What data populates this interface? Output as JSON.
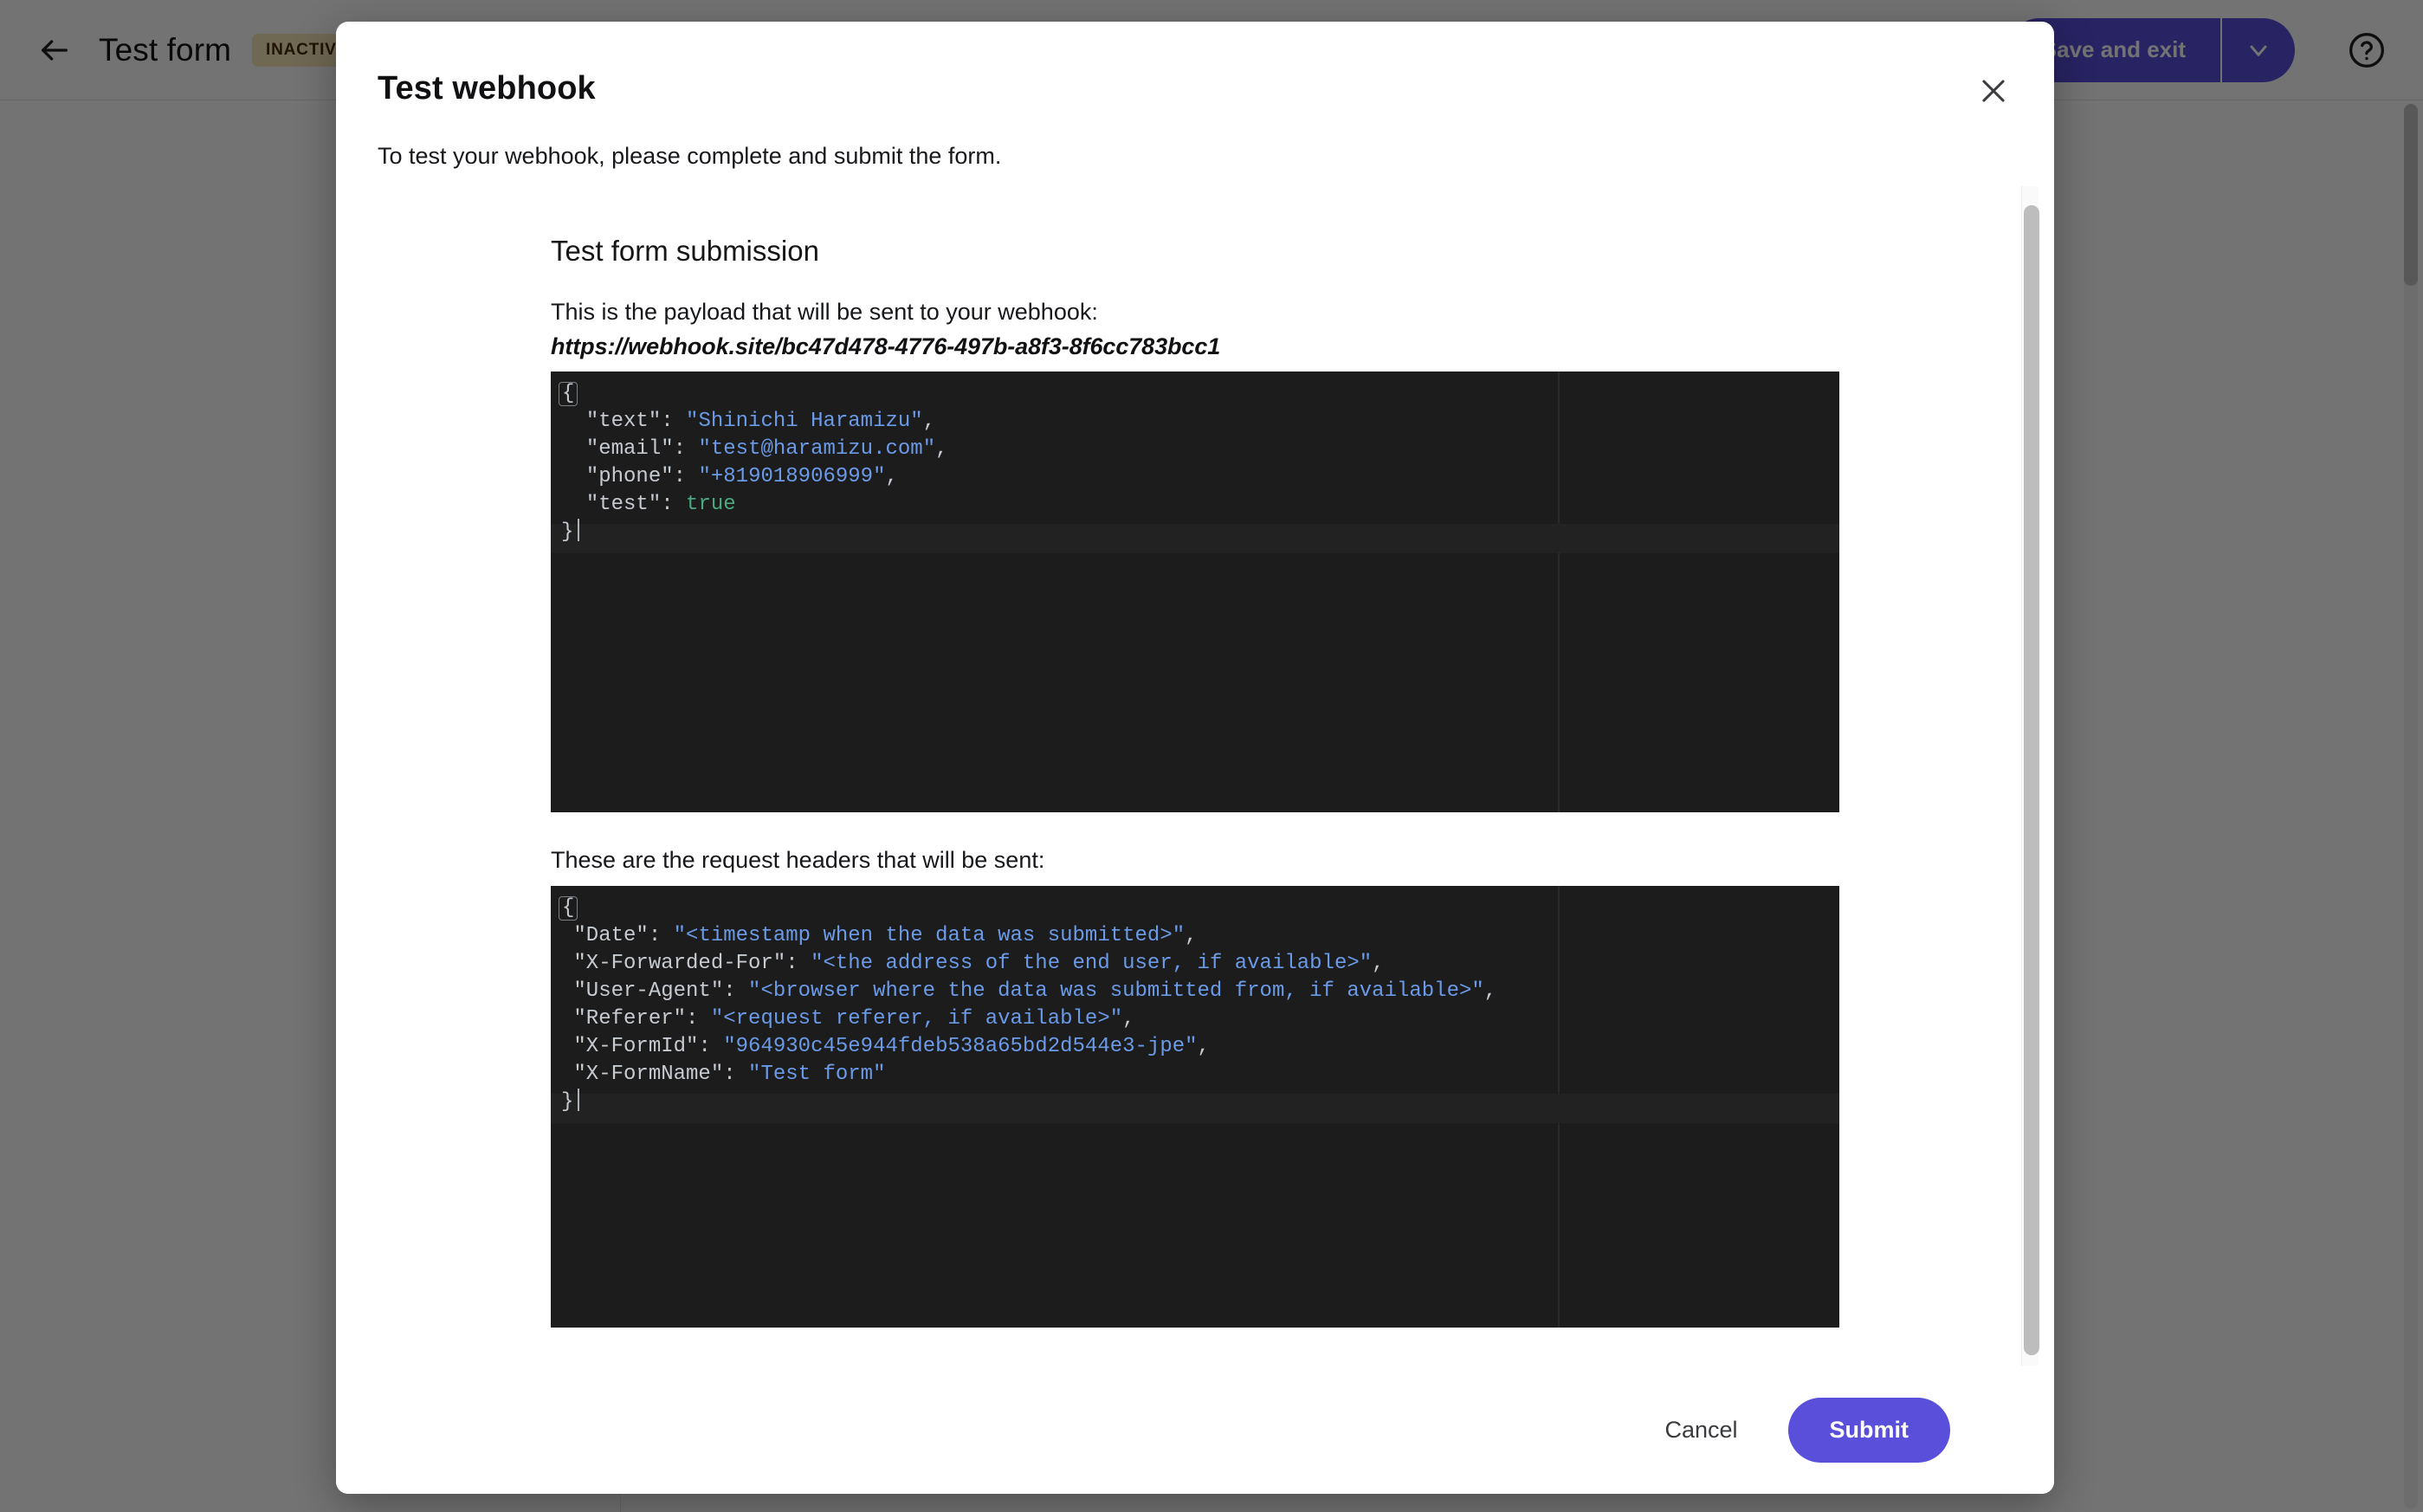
{
  "page": {
    "back_icon": "arrow-left-icon",
    "form_title": "Test form",
    "status_badge": "INACTIVE",
    "save_and_exit_label": "Save and exit",
    "save_menu_icon": "chevron-down-icon",
    "help_icon": "help-circle-icon"
  },
  "modal": {
    "title": "Test webhook",
    "close_icon": "close-icon",
    "intro": "To test your webhook, please complete and submit the form.",
    "section_heading": "Test form submission",
    "payload_label": "This is the payload that will be sent to your webhook:",
    "payload_url": "https://webhook.site/bc47d478-4776-497b-a8f3-8f6cc783bcc1",
    "headers_label": "These are the request headers that will be sent:",
    "cancel_label": "Cancel",
    "submit_label": "Submit"
  },
  "payload_code": {
    "open_brace": "{",
    "close_brace": "}",
    "lines": [
      {
        "key": "\"text\"",
        "value": "\"Shinichi Haramizu\"",
        "type": "string",
        "comma": true
      },
      {
        "key": "\"email\"",
        "value": "\"test@haramizu.com\"",
        "type": "string",
        "comma": true
      },
      {
        "key": "\"phone\"",
        "value": "\"+819018906999\"",
        "type": "string",
        "comma": true
      },
      {
        "key": "\"test\"",
        "value": "true",
        "type": "boolean",
        "comma": false
      }
    ]
  },
  "headers_code": {
    "open_brace": "{",
    "close_brace": "}",
    "lines": [
      {
        "key": "\"Date\"",
        "value": "\"<timestamp when the data was submitted>\"",
        "type": "string",
        "comma": true
      },
      {
        "key": "\"X-Forwarded-For\"",
        "value": "\"<the address of the end user, if available>\"",
        "type": "string",
        "comma": true
      },
      {
        "key": "\"User-Agent\"",
        "value": "\"<browser where the data was submitted from, if available>\"",
        "type": "string",
        "comma": true
      },
      {
        "key": "\"Referer\"",
        "value": "\"<request referer, if available>\"",
        "type": "string",
        "comma": true
      },
      {
        "key": "\"X-FormId\"",
        "value": "\"964930c45e944fdeb538a65bd2d544e3-jpe\"",
        "type": "string",
        "comma": true
      },
      {
        "key": "\"X-FormName\"",
        "value": "\"Test form\"",
        "type": "string",
        "comma": false
      }
    ]
  },
  "colors": {
    "accent": "#5a4fdb",
    "badge_bg": "#f6e7b8",
    "code_bg": "#1c1c1c",
    "code_key": "#c6cad1",
    "code_string": "#6b9ae8",
    "code_boolean": "#4aa97f"
  }
}
